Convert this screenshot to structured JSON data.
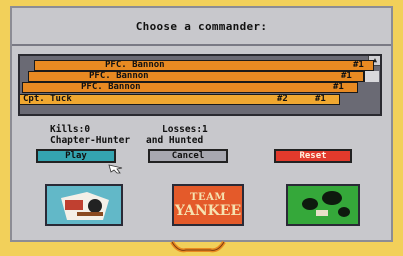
{
  "dialog": {
    "title": "Choose a commander:"
  },
  "commanders": [
    {
      "name": "PFC. Bannon",
      "badge1": "",
      "badge2": "#1",
      "selected": false
    },
    {
      "name": "PFC. Bannon",
      "badge1": "",
      "badge2": "#1",
      "selected": false
    },
    {
      "name": "PFC. Bannon",
      "badge1": "",
      "badge2": "#1",
      "selected": false
    },
    {
      "name": "Cpt. Tuck",
      "badge1": "#2",
      "badge2": "#1",
      "selected": true
    }
  ],
  "stats": {
    "kills": "Kills:0",
    "losses": "Losses:1",
    "scenario_left": "Chapter-Hunter",
    "scenario_right": "and Hunted"
  },
  "buttons": {
    "play": "Play",
    "cancel": "Cancel",
    "reset": "Reset"
  },
  "cards": {
    "team_line1": "TEAM",
    "team_line2": "YANKEE"
  },
  "icons": {
    "scroll_up": "scroll-up-arrow-icon",
    "cursor": "hand-pointer-icon",
    "card_one": "commander-portrait-icon",
    "card_three": "landscape-scene-icon",
    "bottom_tab": "scroll-handle-icon"
  },
  "colors": {
    "background": "#f2d05a",
    "row_orange": "#e88a22",
    "play_teal": "#34a4b0",
    "reset_red": "#e23a2c"
  }
}
